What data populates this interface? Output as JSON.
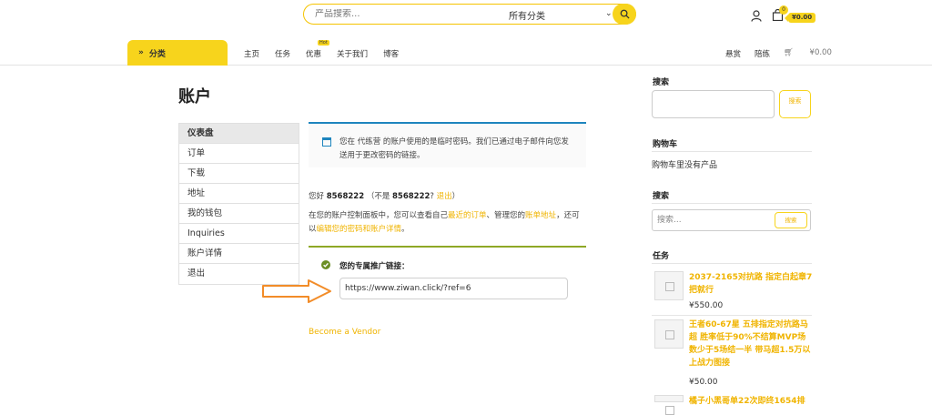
{
  "header": {
    "search_placeholder": "产品搜索...",
    "category_select": "所有分类",
    "cart_count": "0",
    "cart_total": "¥0.00"
  },
  "nav": {
    "categories_label": "分类",
    "items": [
      "主页",
      "任务",
      "优惠",
      "关于我们",
      "博客"
    ],
    "hot_badge": "Hot",
    "right": [
      "悬赏",
      "陪练"
    ],
    "cart_total": "¥0.00"
  },
  "page": {
    "title": "账户"
  },
  "sidebar": {
    "items": [
      "仪表盘",
      "订单",
      "下载",
      "地址",
      "我的钱包",
      "Inquiries",
      "账户详情",
      "退出"
    ]
  },
  "notice": {
    "text": "您在 代练营 的账户使用的是临时密码。我们已通过电子邮件向您发送用于更改密码的链接。"
  },
  "greeting": {
    "hello": "您好 ",
    "username": "8568222",
    "not_prefix": "（不是 ",
    "not_user": "8568222",
    "q": "? ",
    "logout": "退出",
    "close": "）"
  },
  "dashboard_desc": {
    "part1": "在您的账户控制面板中，您可以查看自己",
    "link1": "最近的订单",
    "part2": "、管理您的",
    "link2": "账单地址",
    "part3": "，还可以",
    "link3": "编辑您的密码和账户详情",
    "part4": "。"
  },
  "affiliate": {
    "label": "您的专属推广链接：",
    "link": "https://www.ziwan.click/?ref=6"
  },
  "vendor_link": "Become a Vendor",
  "right_sidebar": {
    "search_title": "搜索",
    "search_btn": "搜索",
    "cart_title": "购物车",
    "cart_empty": "购物车里没有产品",
    "search2_title": "搜索",
    "search2_placeholder": "搜索...",
    "search2_btn": "搜索",
    "tasks_title": "任务",
    "tasks": [
      {
        "name": "2037-2165对抗路 指定白起章7把就行",
        "price": "¥550.00"
      },
      {
        "name": "王者60-67星 五排指定对抗路马超 胜率低于90%不结算MVP场数少于5场结一半 带马超1.5万以上战力图接",
        "price": "¥50.00"
      },
      {
        "name": "橘子小黑哥单22次即终1654排",
        "price": ""
      }
    ]
  },
  "colors": {
    "accent": "#f7d41c",
    "link": "#f0b400",
    "info": "#1e85be",
    "success": "#8ea826"
  }
}
